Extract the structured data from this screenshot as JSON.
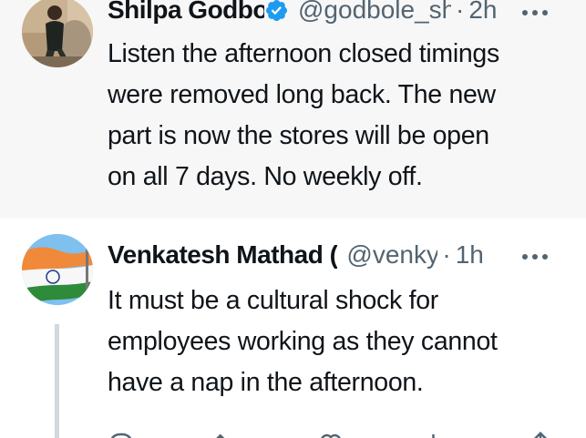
{
  "tweets": [
    {
      "author_name": "Shilpa Godbole",
      "verified_icon": "verified-badge-icon",
      "handle": "@godbole_shilpa",
      "separator": "·",
      "time": "2h",
      "more_icon": "more-options-icon",
      "text_lines": [
        "Listen the afternoon closed timings",
        "were removed long back. The new",
        "part is now the stores will be open",
        "on all 7 days. No weekly off."
      ]
    },
    {
      "author_name": "Venkatesh Mathad (",
      "handle": "@venky",
      "separator": "·",
      "time": "1h",
      "more_icon": "more-options-icon",
      "text_lines": [
        "It must be a cultural shock for",
        "employees working as they cannot",
        "have a nap in the afternoon."
      ],
      "actions": [
        "reply-icon",
        "retweet-icon",
        "like-icon",
        "views-icon",
        "share-icon"
      ]
    }
  ],
  "colors": {
    "text_primary": "#0f1419",
    "text_secondary": "#536471",
    "verified_blue": "#1d9bf0",
    "highlight_bg": "#f7f7f7",
    "thread_line": "#cfd9de"
  }
}
